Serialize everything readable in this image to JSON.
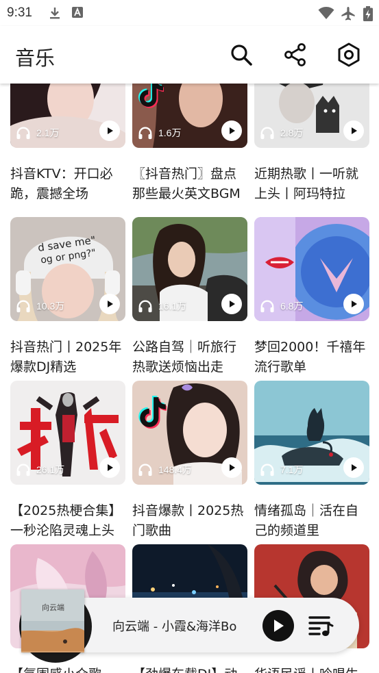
{
  "status_bar": {
    "time": "9:31",
    "left_icons": [
      "download-icon",
      "text-a-icon"
    ],
    "right_icons": [
      "wifi-icon",
      "airplane-icon",
      "battery-charging-icon"
    ]
  },
  "app_bar": {
    "title": "音乐",
    "actions": [
      "search-icon",
      "share-icon",
      "settings-icon"
    ]
  },
  "playlists": [
    {
      "title_line1": "抖音KTV：开口必",
      "title_line2": "跪，震撼全场",
      "plays": "2.1万"
    },
    {
      "title_line1": "〖抖音热门〗盘点",
      "title_line2": "那些最火英文BGM",
      "plays": "1.6万"
    },
    {
      "title_line1": "近期热歌丨一听就",
      "title_line2": "上头丨阿玛特拉",
      "plays": "2.8万"
    },
    {
      "title_line1": "抖音热门丨2025年",
      "title_line2": "爆款DJ精选",
      "plays": "10.3万"
    },
    {
      "title_line1": "公路自驾｜听旅行",
      "title_line2": "热歌送烦恼出走",
      "plays": "16.1万"
    },
    {
      "title_line1": "梦回2000！千禧年",
      "title_line2": "流行歌单",
      "plays": "6.8万"
    },
    {
      "title_line1": "【2025热梗合集】",
      "title_line2": "一秒沦陷灵魂上头",
      "plays": "26.1万"
    },
    {
      "title_line1": "抖音爆款丨2025热",
      "title_line2": "门歌曲",
      "plays": "148.4万"
    },
    {
      "title_line1": "情绪孤岛｜活在自",
      "title_line2": "己的频道里",
      "plays": "7.1万"
    },
    {
      "title_line1": "【氛围感小众歌",
      "title_line2": "",
      "plays": ""
    },
    {
      "title_line1": "【劲爆车载DJ】动",
      "title_line2": "",
      "plays": ""
    },
    {
      "title_line1": "华语民谣丨吟唱生",
      "title_line2": "",
      "plays": ""
    }
  ],
  "player": {
    "song": "向云端 - 小霞&海洋Bo",
    "cover_text": "向云端",
    "controls": [
      "play-icon",
      "playlist-icon"
    ]
  },
  "colors": {
    "accent": "#111111",
    "background": "#ffffff",
    "player_bg": "#f3f3f4"
  }
}
